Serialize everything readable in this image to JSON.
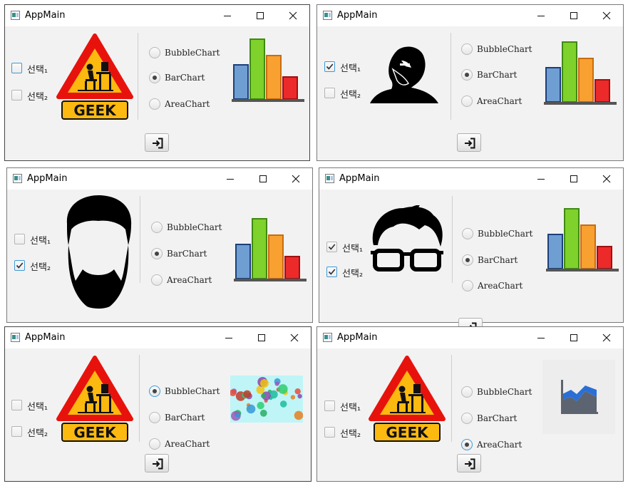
{
  "app": {
    "title": "AppMain"
  },
  "labels": {
    "check1": "선택₁",
    "check2": "선택₂",
    "radio_bubble": "BubbleChart",
    "radio_bar": "BarChart",
    "radio_area": "AreaChart",
    "geek_sign_text": "GEEK"
  },
  "windows": [
    {
      "id": "w1",
      "check1": false,
      "check2": false,
      "focus": "check1",
      "picture": "geek-sign-icon",
      "radio": "BarChart",
      "chart": "bar-chart-icon"
    },
    {
      "id": "w2",
      "check1": true,
      "check2": false,
      "focus": "check1",
      "picture": "thinking-man-icon",
      "radio": "BarChart",
      "chart": "bar-chart-icon"
    },
    {
      "id": "w3",
      "check1": false,
      "check2": true,
      "focus": "check2",
      "picture": "bearded-man-icon",
      "radio": "BarChart",
      "chart": "bar-chart-icon"
    },
    {
      "id": "w4",
      "check1": true,
      "check2": true,
      "focus": "check2",
      "picture": "glasses-man-icon",
      "radio": "BarChart",
      "chart": "bar-chart-icon"
    },
    {
      "id": "w5",
      "check1": false,
      "check2": false,
      "focus": "radio",
      "picture": "geek-sign-icon",
      "radio": "BubbleChart",
      "chart": "bubble-chart-thumbnail"
    },
    {
      "id": "w6",
      "check1": false,
      "check2": false,
      "focus": "radio",
      "picture": "geek-sign-icon",
      "radio": "AreaChart",
      "chart": "area-chart-icon"
    }
  ],
  "colors": {
    "sign_red": "#e8120c",
    "sign_yellow": "#fcb90f",
    "bar_blue": "#6f9ed3",
    "bar_green": "#7fd12b",
    "bar_orange": "#f8a030",
    "bar_red": "#ec2a2a",
    "focus_blue": "#3d9ad6",
    "area_blue": "#2a6fd6",
    "area_gray": "#5b6470"
  }
}
